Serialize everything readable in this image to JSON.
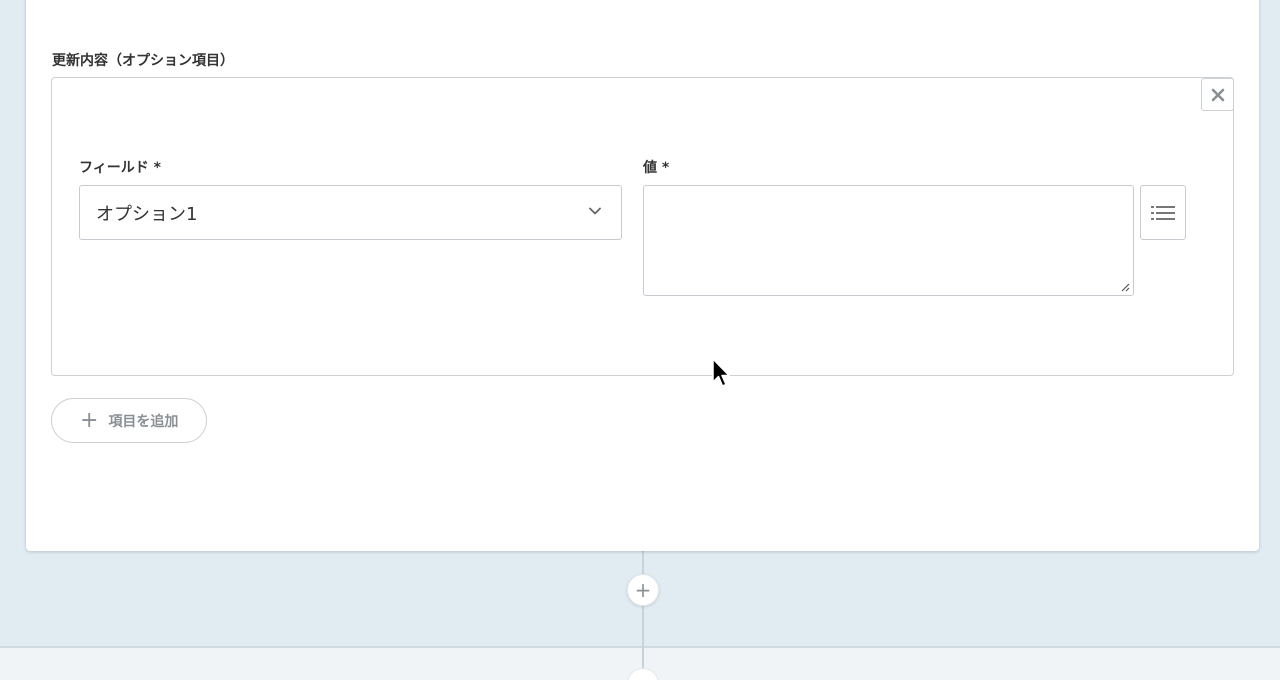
{
  "update_section": {
    "label": "更新内容（オプション項目）"
  },
  "mapping": {
    "field_label": "フィールド *",
    "field_value": "オプション1",
    "value_label": "値 *",
    "value_text": ""
  },
  "remove_icon": "close-icon",
  "add_item_button": {
    "plus": "+",
    "label": "項目を追加"
  },
  "add_step_button": {
    "plus": "+"
  }
}
